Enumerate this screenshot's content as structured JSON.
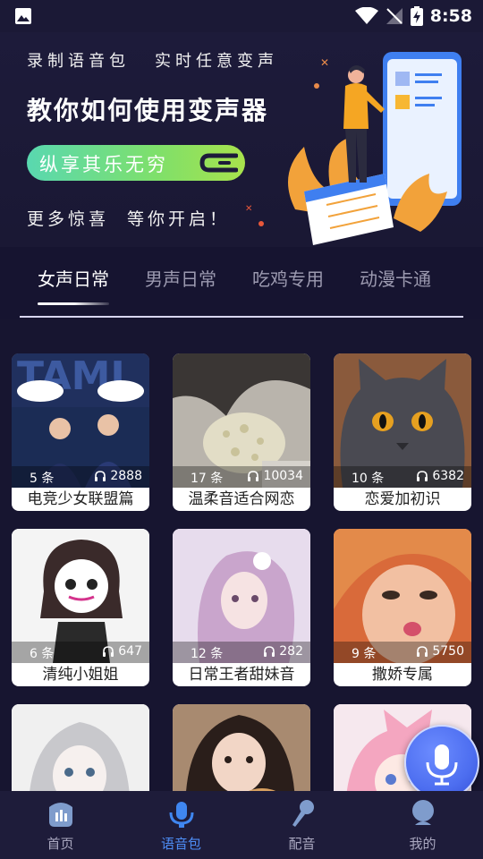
{
  "status_bar": {
    "time": "8:58"
  },
  "banner": {
    "top_left": "录制语音包",
    "top_right": "实时任意变声",
    "title": "教你如何使用变声器",
    "pill": "纵享其乐无穷",
    "bottom_left": "更多惊喜",
    "bottom_right": "等你开启！"
  },
  "tabs": [
    "女声日常",
    "男声日常",
    "吃鸡专用",
    "动漫卡通"
  ],
  "cards": [
    {
      "count": "5 条",
      "plays": "2888",
      "title": "电竞少女联盟篇"
    },
    {
      "count": "17 条",
      "plays": "10034",
      "title": "温柔音适合网恋"
    },
    {
      "count": "10 条",
      "plays": "6382",
      "title": "恋爱加初识"
    },
    {
      "count": "6 条",
      "plays": "647",
      "title": "清纯小姐姐"
    },
    {
      "count": "12 条",
      "plays": "282",
      "title": "日常王者甜妹音"
    },
    {
      "count": "9 条",
      "plays": "5750",
      "title": "撒娇专属"
    },
    {
      "count": "",
      "plays": "",
      "title": ""
    },
    {
      "count": "",
      "plays": "",
      "title": ""
    },
    {
      "count": "",
      "plays": "",
      "title": ""
    }
  ],
  "nav": [
    {
      "label": "首页",
      "icon": "home-icon"
    },
    {
      "label": "语音包",
      "icon": "voice-pack-icon"
    },
    {
      "label": "配音",
      "icon": "microphone-icon"
    },
    {
      "label": "我的",
      "icon": "profile-icon"
    }
  ],
  "colors": {
    "background": "#171530",
    "accent": "#4d8df5",
    "pill": "#7fe06a"
  }
}
